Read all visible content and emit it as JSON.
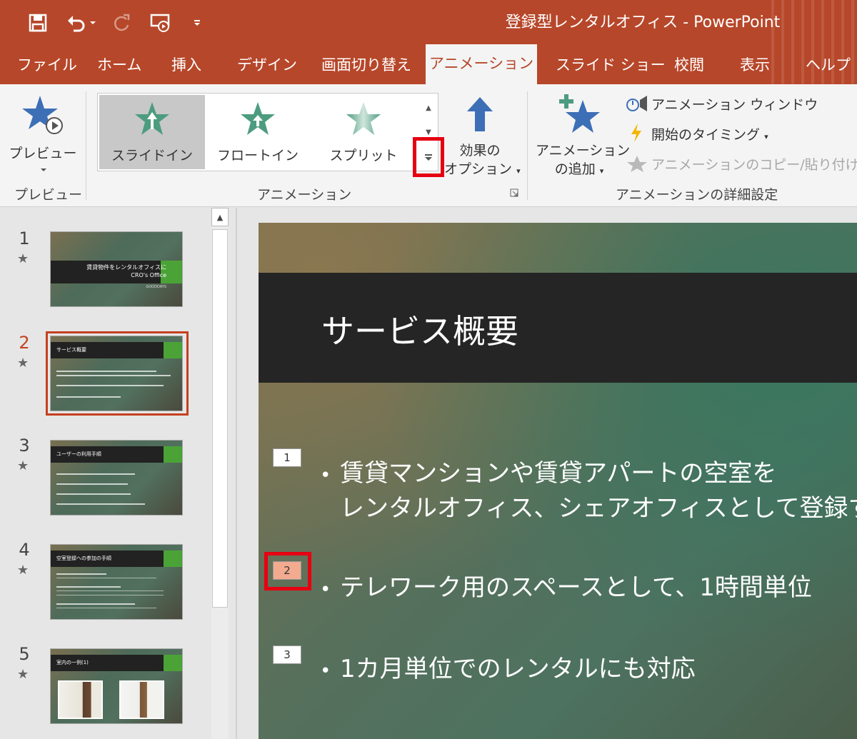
{
  "window": {
    "title": "登録型レンタルオフィス  -  PowerPoint"
  },
  "qat": {
    "save": "save-icon",
    "undo": "undo-icon",
    "redo": "redo-icon",
    "slideshow": "slideshow-from-start-icon",
    "customize": "customize-qat-icon"
  },
  "tabs": [
    {
      "label": "ファイル"
    },
    {
      "label": "ホーム"
    },
    {
      "label": "挿入"
    },
    {
      "label": "デザイン"
    },
    {
      "label": "画面切り替え"
    },
    {
      "label": "アニメーション",
      "active": true
    },
    {
      "label": "スライド ショー"
    },
    {
      "label": "校閲"
    },
    {
      "label": "表示"
    },
    {
      "label": "ヘルプ"
    }
  ],
  "ribbon": {
    "preview": {
      "button_label": "プレビュー",
      "group_label": "プレビュー"
    },
    "animation": {
      "gallery": [
        "スライドイン",
        "フロートイン",
        "スプリット"
      ],
      "selected": "スライドイン",
      "effect_options_line1": "効果の",
      "effect_options_line2": "オプション",
      "group_label": "アニメーション"
    },
    "advanced": {
      "add_line1": "アニメーション",
      "add_line2": "の追加",
      "pane": "アニメーション ウィンドウ",
      "trigger": "開始のタイミング",
      "painter": "アニメーションのコピー/貼り付け",
      "group_label": "アニメーションの詳細設定"
    }
  },
  "thumbnails": [
    {
      "num": "1",
      "title_line1": "賃貸物件をレンタルオフィスに",
      "title_line2": "CRO's Office",
      "subtitle": "GOODDAYS"
    },
    {
      "num": "2",
      "title": "サービス概要",
      "active": true
    },
    {
      "num": "3",
      "title": "ユーザーの利用手順"
    },
    {
      "num": "4",
      "title": "空室登録への参加の手順"
    },
    {
      "num": "5",
      "title": "室内の一例(1)"
    }
  ],
  "slide": {
    "title": "サービス概要",
    "bullets": [
      {
        "badge": "1",
        "line1": "賃貸マンションや賃貸アパートの空室を",
        "line2": "レンタルオフィス、シェアオフィスとして登録す"
      },
      {
        "badge": "2",
        "line1": "テレワーク用のスペースとして、1時間単位"
      },
      {
        "badge": "3",
        "line1": "1カ月単位でのレンタルにも対応"
      }
    ],
    "selected_badge": "2"
  },
  "colors": {
    "accent": "#b7472a",
    "highlight": "#e60012",
    "slide_green": "#4ba337"
  }
}
